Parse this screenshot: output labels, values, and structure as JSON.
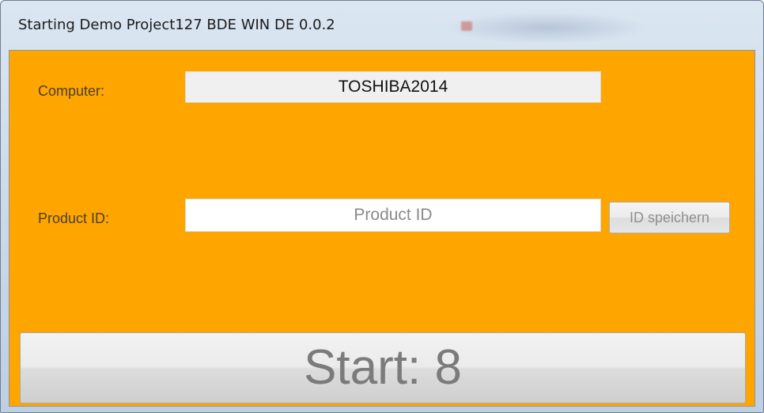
{
  "window": {
    "title": "Starting Demo Project127 BDE WIN DE 0.0.2"
  },
  "form": {
    "computer_label": "Computer:",
    "computer_value": "TOSHIBA2014",
    "product_label": "Product ID:",
    "product_value": "",
    "product_placeholder": "Product ID",
    "save_button_label": "ID speichern",
    "start_button_label": "Start: 8"
  },
  "colors": {
    "client_background": "#ffa500",
    "titlebar": "#dbe6f2"
  }
}
